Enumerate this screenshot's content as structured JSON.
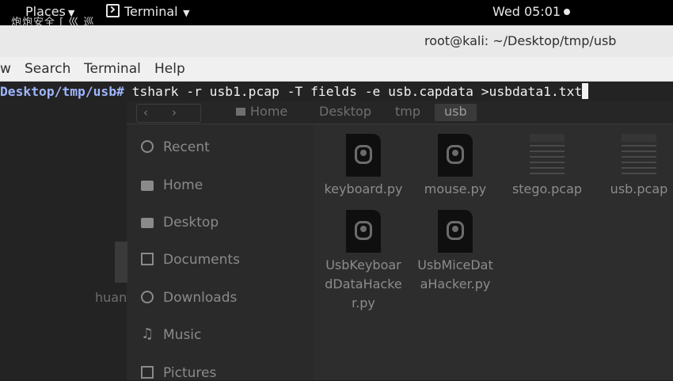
{
  "topbar": {
    "places": "Places",
    "overlay_text": "炮炮安全 [ 巛 巡",
    "terminal_menu": "Terminal",
    "clock": "Wed 05:01"
  },
  "window": {
    "title": "root@kali: ~/Desktop/tmp/usb"
  },
  "menubar": {
    "items": [
      "w",
      "Search",
      "Terminal",
      "Help"
    ]
  },
  "terminal": {
    "prompt": "Desktop/tmp/usb#",
    "command": " tshark -r usb1.pcap -T fields -e usb.capdata >usbdata1.txt"
  },
  "file_manager": {
    "breadcrumbs": [
      "Home",
      "Desktop",
      "tmp",
      "usb"
    ],
    "sidebar": [
      "Recent",
      "Home",
      "Desktop",
      "Documents",
      "Downloads",
      "Music",
      "Pictures"
    ],
    "files": [
      {
        "name": "keyboard.py",
        "type": "python"
      },
      {
        "name": "mouse.py",
        "type": "python"
      },
      {
        "name": "stego.pcap",
        "type": "pcap"
      },
      {
        "name": "usb.pcap",
        "type": "pcap"
      },
      {
        "name": "UsbKeyboardDataHacker.py",
        "type": "python"
      },
      {
        "name": "UsbMiceDataHacker.py",
        "type": "python"
      }
    ],
    "file_name_lines": [
      [
        "keyboard.py"
      ],
      [
        "mouse.py"
      ],
      [
        "stego.pcap"
      ],
      [
        "usb.pcap"
      ],
      [
        "UsbKeyboar",
        "dDataHacke",
        "r.py"
      ],
      [
        "UsbMiceDat",
        "aHacker.py"
      ]
    ]
  },
  "background": {
    "ghost_label": "huan"
  }
}
